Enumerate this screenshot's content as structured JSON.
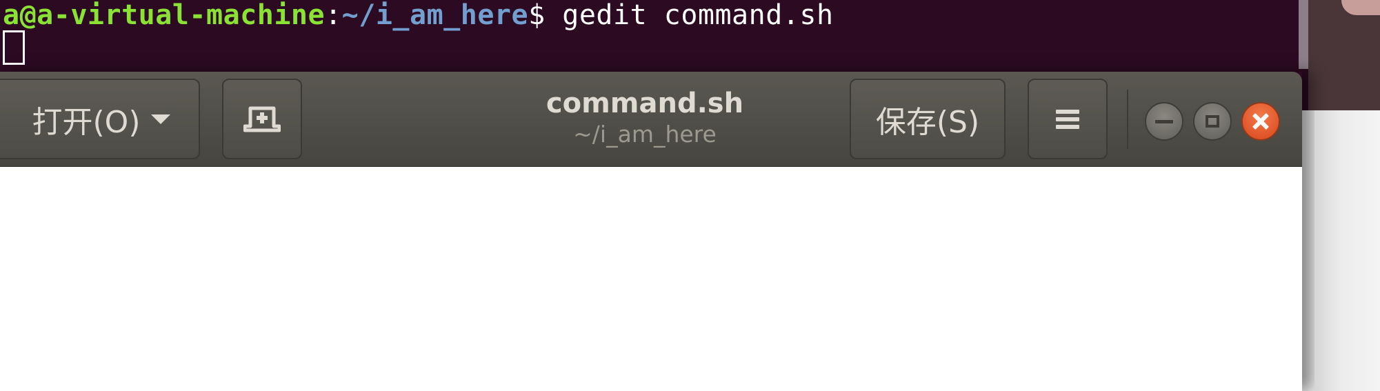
{
  "terminal": {
    "prompt_user": "a@a-virtual-machine",
    "prompt_separator": ":",
    "prompt_path": "~/i_am_here",
    "prompt_dollar": "$",
    "command": " gedit command.sh",
    "colors": {
      "background": "#2c0a22",
      "user": "#8ae234",
      "path": "#729fcf"
    }
  },
  "gedit": {
    "open_label": "打开(O)",
    "new_tab_icon": "new-tab-icon",
    "title": "command.sh",
    "subtitle": "~/i_am_here",
    "save_label": "保存(S)",
    "menu_icon": "hamburger-menu-icon",
    "window_controls": [
      "minimize-icon",
      "maximize-icon",
      "close-icon"
    ],
    "editor_content": "",
    "colors": {
      "headerbar": "#4e4d47",
      "close_button": "#e05a2b"
    }
  }
}
